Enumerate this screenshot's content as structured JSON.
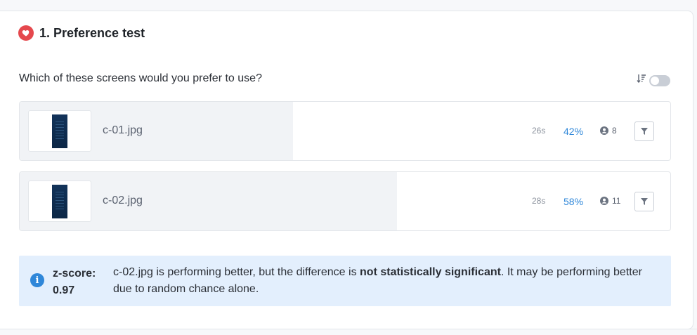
{
  "test": {
    "title": "1. Preference test",
    "question": "Which of these screens would you prefer to use?"
  },
  "options": [
    {
      "filename": "c-01.jpg",
      "time": "26s",
      "percent": "42%",
      "share": 0.42,
      "count": "8"
    },
    {
      "filename": "c-02.jpg",
      "time": "28s",
      "percent": "58%",
      "share": 0.58,
      "count": "11"
    }
  ],
  "stat": {
    "label_line1": "z-score:",
    "label_line2": "0.97",
    "msg_before": "c-02.jpg is performing better, but the difference is ",
    "msg_bold": "not statistically significant",
    "msg_after": ". It may be performing better due to random chance alone."
  },
  "icons": {
    "header": "heart-icon",
    "sort": "sort-descending-icon",
    "users": "user-icon",
    "filter": "filter-icon",
    "info": "info-icon"
  },
  "colors": {
    "accent": "#2f87d9",
    "heart": "#e5484d",
    "info_bg": "#e3effd",
    "bar_fill": "#f1f3f6"
  }
}
